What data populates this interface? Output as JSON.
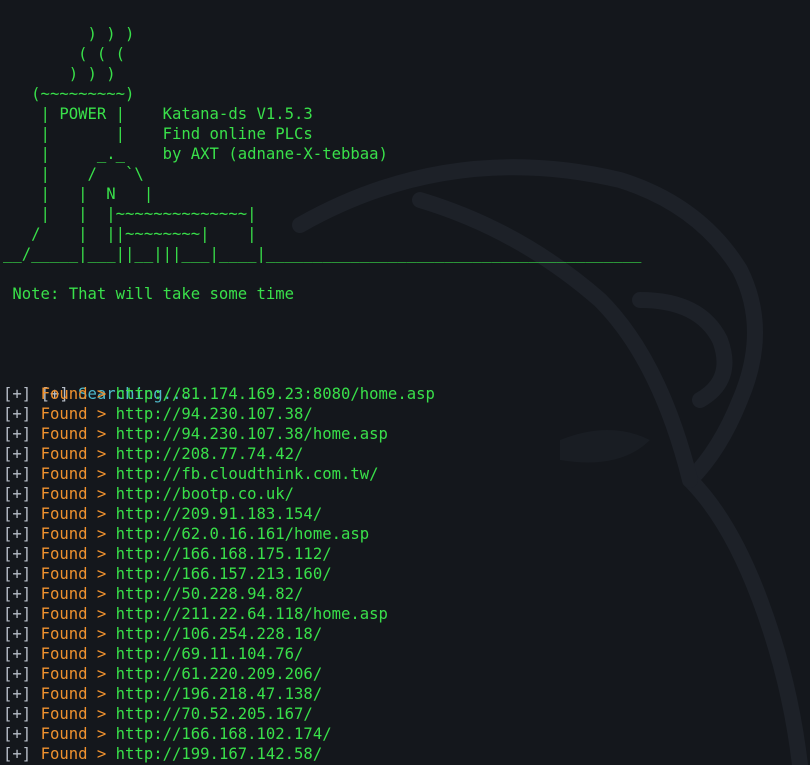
{
  "banner": {
    "lines": [
      "         ) ) )",
      "        ( ( (",
      "       ) ) )",
      "   (~~~~~~~~~)",
      "    | POWER |    Katana-ds V1.5.3",
      "    |       |    Find online PLCs",
      "    |     _._    by AXT (adnane-X-tebbaa)",
      "    |    /   `\\",
      "    |   |  N   |",
      "    |   |  |~~~~~~~~~~~~~~|",
      "   /    |  ||~~~~~~~~|    |",
      "__/_____|___||__|||___|____|________________________________________"
    ]
  },
  "note": " Note: That will take some time",
  "log": {
    "searching_prefix": "[+]",
    "searching_text": "Searching...",
    "entry_prefix": "[+]",
    "entry_label": "Found >",
    "entries": [
      "http://81.174.169.23:8080/home.asp",
      "http://94.230.107.38/",
      "http://94.230.107.38/home.asp",
      "http://208.77.74.42/",
      "http://fb.cloudthink.com.tw/",
      "http://bootp.co.uk/",
      "http://209.91.183.154/",
      "http://62.0.16.161/home.asp",
      "http://166.168.175.112/",
      "http://166.157.213.160/",
      "http://50.228.94.82/",
      "http://211.22.64.118/home.asp",
      "http://106.254.228.18/",
      "http://69.11.104.76/",
      "http://61.220.209.206/",
      "http://196.218.47.138/",
      "http://70.52.205.167/",
      "http://166.168.102.174/",
      "http://199.167.142.58/"
    ]
  },
  "colors": {
    "background": "#14171c",
    "ascii_green": "#39e04a",
    "prefix_gray": "#b7bec8",
    "searching_cyan": "#4fb8c9",
    "found_orange": "#f0922f"
  },
  "watermark_icon": "dragon-watermark-icon"
}
